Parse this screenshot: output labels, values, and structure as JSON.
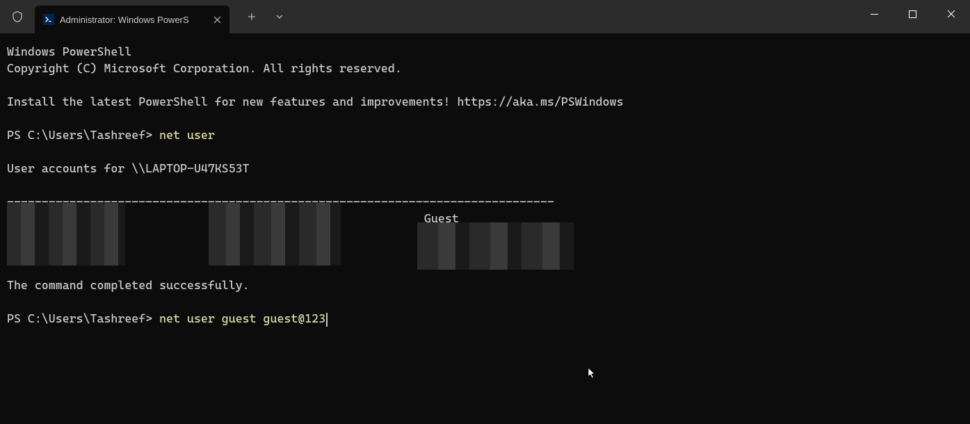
{
  "tab": {
    "title": "Administrator: Windows PowerS"
  },
  "terminal": {
    "line1": "Windows PowerShell",
    "line2": "Copyright (C) Microsoft Corporation. All rights reserved.",
    "line3": "Install the latest PowerShell for new features and improvements! https://aka.ms/PSWindows",
    "prompt1": "PS C:\\Users\\Tashreef> ",
    "cmd1": "net user",
    "accounts_header": "User accounts for \\\\LAPTOP-U47KS53T",
    "separator": "-------------------------------------------------------------------------------",
    "guest_user": "Guest",
    "completed": "The command completed successfully.",
    "prompt2": "PS C:\\Users\\Tashreef> ",
    "cmd2": "net user guest guest@123"
  }
}
